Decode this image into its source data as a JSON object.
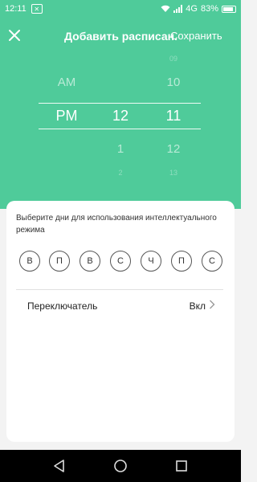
{
  "status_bar": {
    "time": "12:11",
    "network": "4G",
    "battery": "83%"
  },
  "header": {
    "title": "Добавить расписан.",
    "save_label": "Сохранить"
  },
  "time_picker": {
    "ampm": {
      "above": "AM",
      "selected": "PM"
    },
    "hour": {
      "selected": "12",
      "below": "1",
      "below_faint": "2"
    },
    "minute": {
      "above_faint": "09",
      "above": "10",
      "selected": "11",
      "below": "12",
      "below_faint": "13"
    }
  },
  "days": {
    "prompt": "Выберите дни для использования интеллектуального режима",
    "items": [
      "В",
      "П",
      "В",
      "С",
      "Ч",
      "П",
      "С"
    ]
  },
  "switch_row": {
    "label": "Переключатель",
    "value": "Вкл"
  },
  "colors": {
    "accent": "#4fcb9a",
    "sheet": "#ffffff",
    "background": "#f3f3f3"
  }
}
